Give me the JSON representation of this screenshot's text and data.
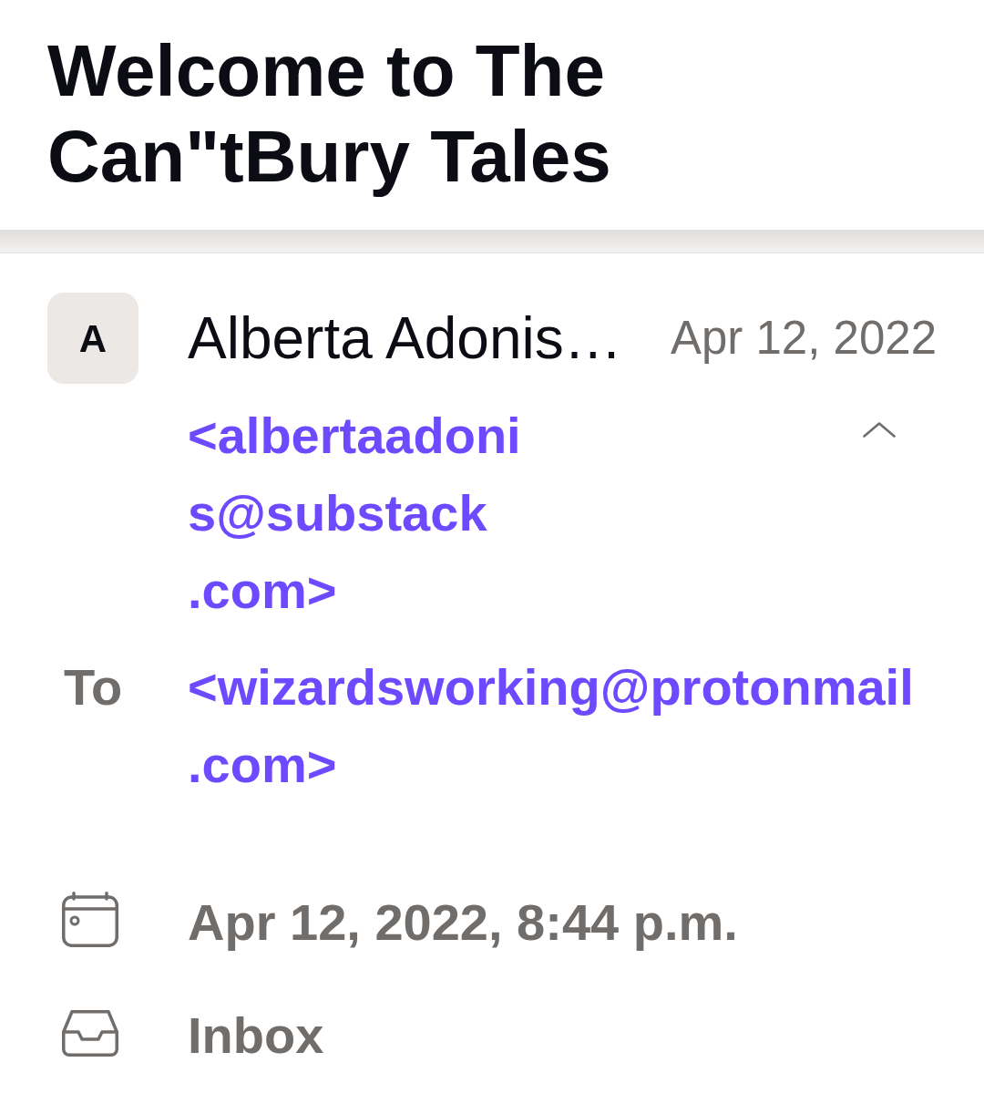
{
  "header": {
    "title": "Welcome to The Can\"tBury Tales"
  },
  "sender": {
    "initial": "A",
    "name": "Alberta Adonis…",
    "date": "Apr 12, 2022",
    "address": "<albertaadonis@substack.com>",
    "expanded": true
  },
  "recipients": {
    "label": "To",
    "addresses": [
      "<wizardsworking@protonmail.com>"
    ]
  },
  "details": [
    {
      "kind": "date",
      "text": "Apr 12, 2022, 8:44 p.m."
    },
    {
      "kind": "folder",
      "text": "Inbox"
    }
  ]
}
